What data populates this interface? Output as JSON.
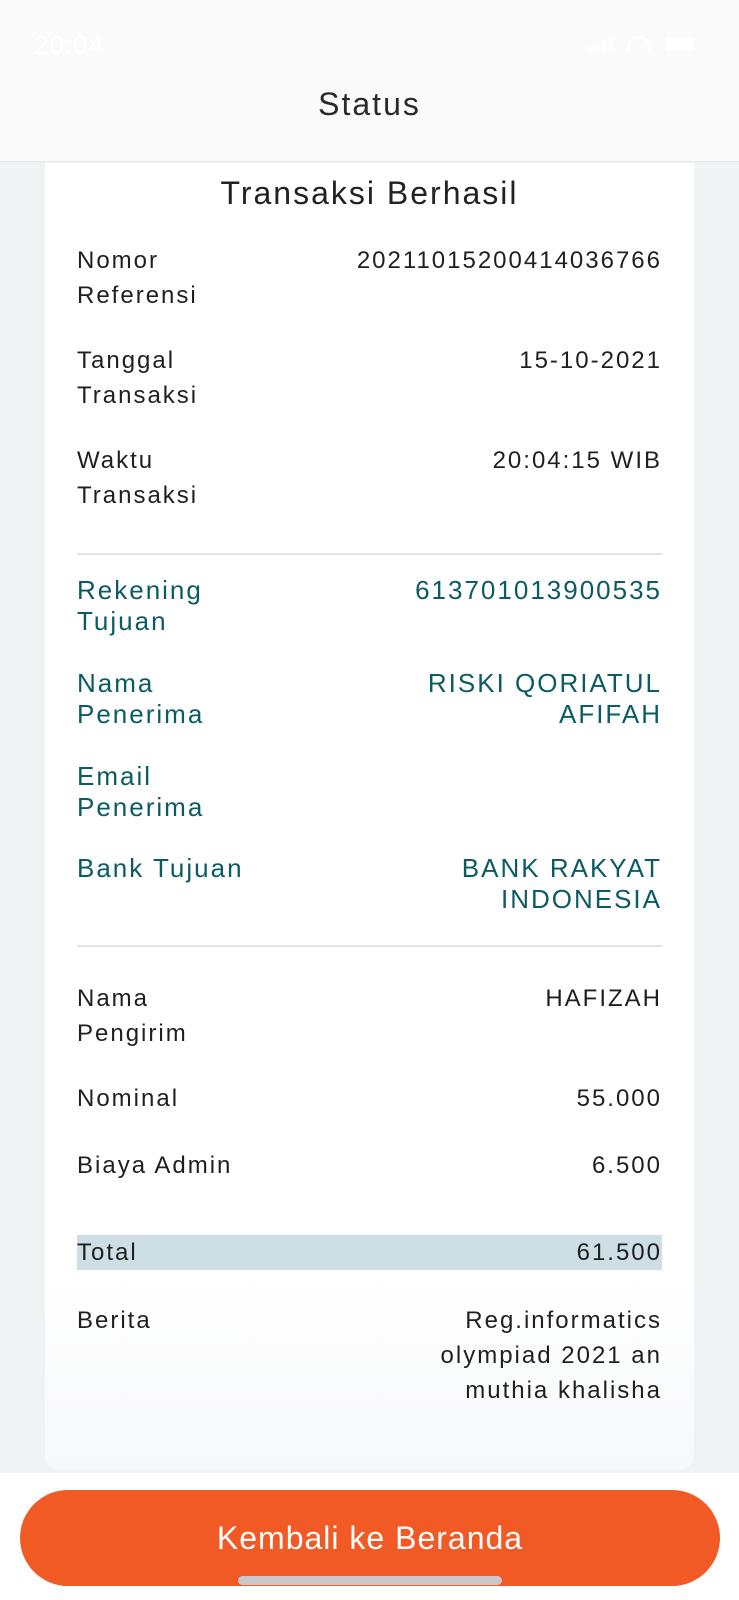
{
  "status_bar": {
    "time": "20:04"
  },
  "header": {
    "title": "Status"
  },
  "receipt": {
    "title": "Transaksi Berhasil",
    "reference_label": "Nomor\nReferensi",
    "reference_value": "20211015200414036766",
    "date_label": "Tanggal\nTransaksi",
    "date_value": "15-10-2021",
    "time_label": "Waktu\nTransaksi",
    "time_value": "20:04:15 WIB",
    "dest_account_label": "Rekening\nTujuan",
    "dest_account_value": "613701013900535",
    "recipient_name_label": "Nama\nPenerima",
    "recipient_name_value": "RISKI QORIATUL\nAFIFAH",
    "recipient_email_label": "Email\nPenerima",
    "recipient_email_value": "",
    "dest_bank_label": "Bank Tujuan",
    "dest_bank_value": "BANK RAKYAT\nINDONESIA",
    "sender_name_label": "Nama\nPengirim",
    "sender_name_value": "HAFIZAH",
    "nominal_label": "Nominal",
    "nominal_value": "55.000",
    "admin_fee_label": "Biaya Admin",
    "admin_fee_value": "6.500",
    "total_label": "Total",
    "total_value": "61.500",
    "note_label": "Berita",
    "note_value": "Reg.informatics\nolympiad 2021 an\nmuthia khalisha"
  },
  "footer": {
    "home_button_label": "Kembali ke Beranda"
  },
  "colors": {
    "accent": "#f15a24",
    "teal": "#0b5b63",
    "total_highlight": "#cddfe4"
  }
}
